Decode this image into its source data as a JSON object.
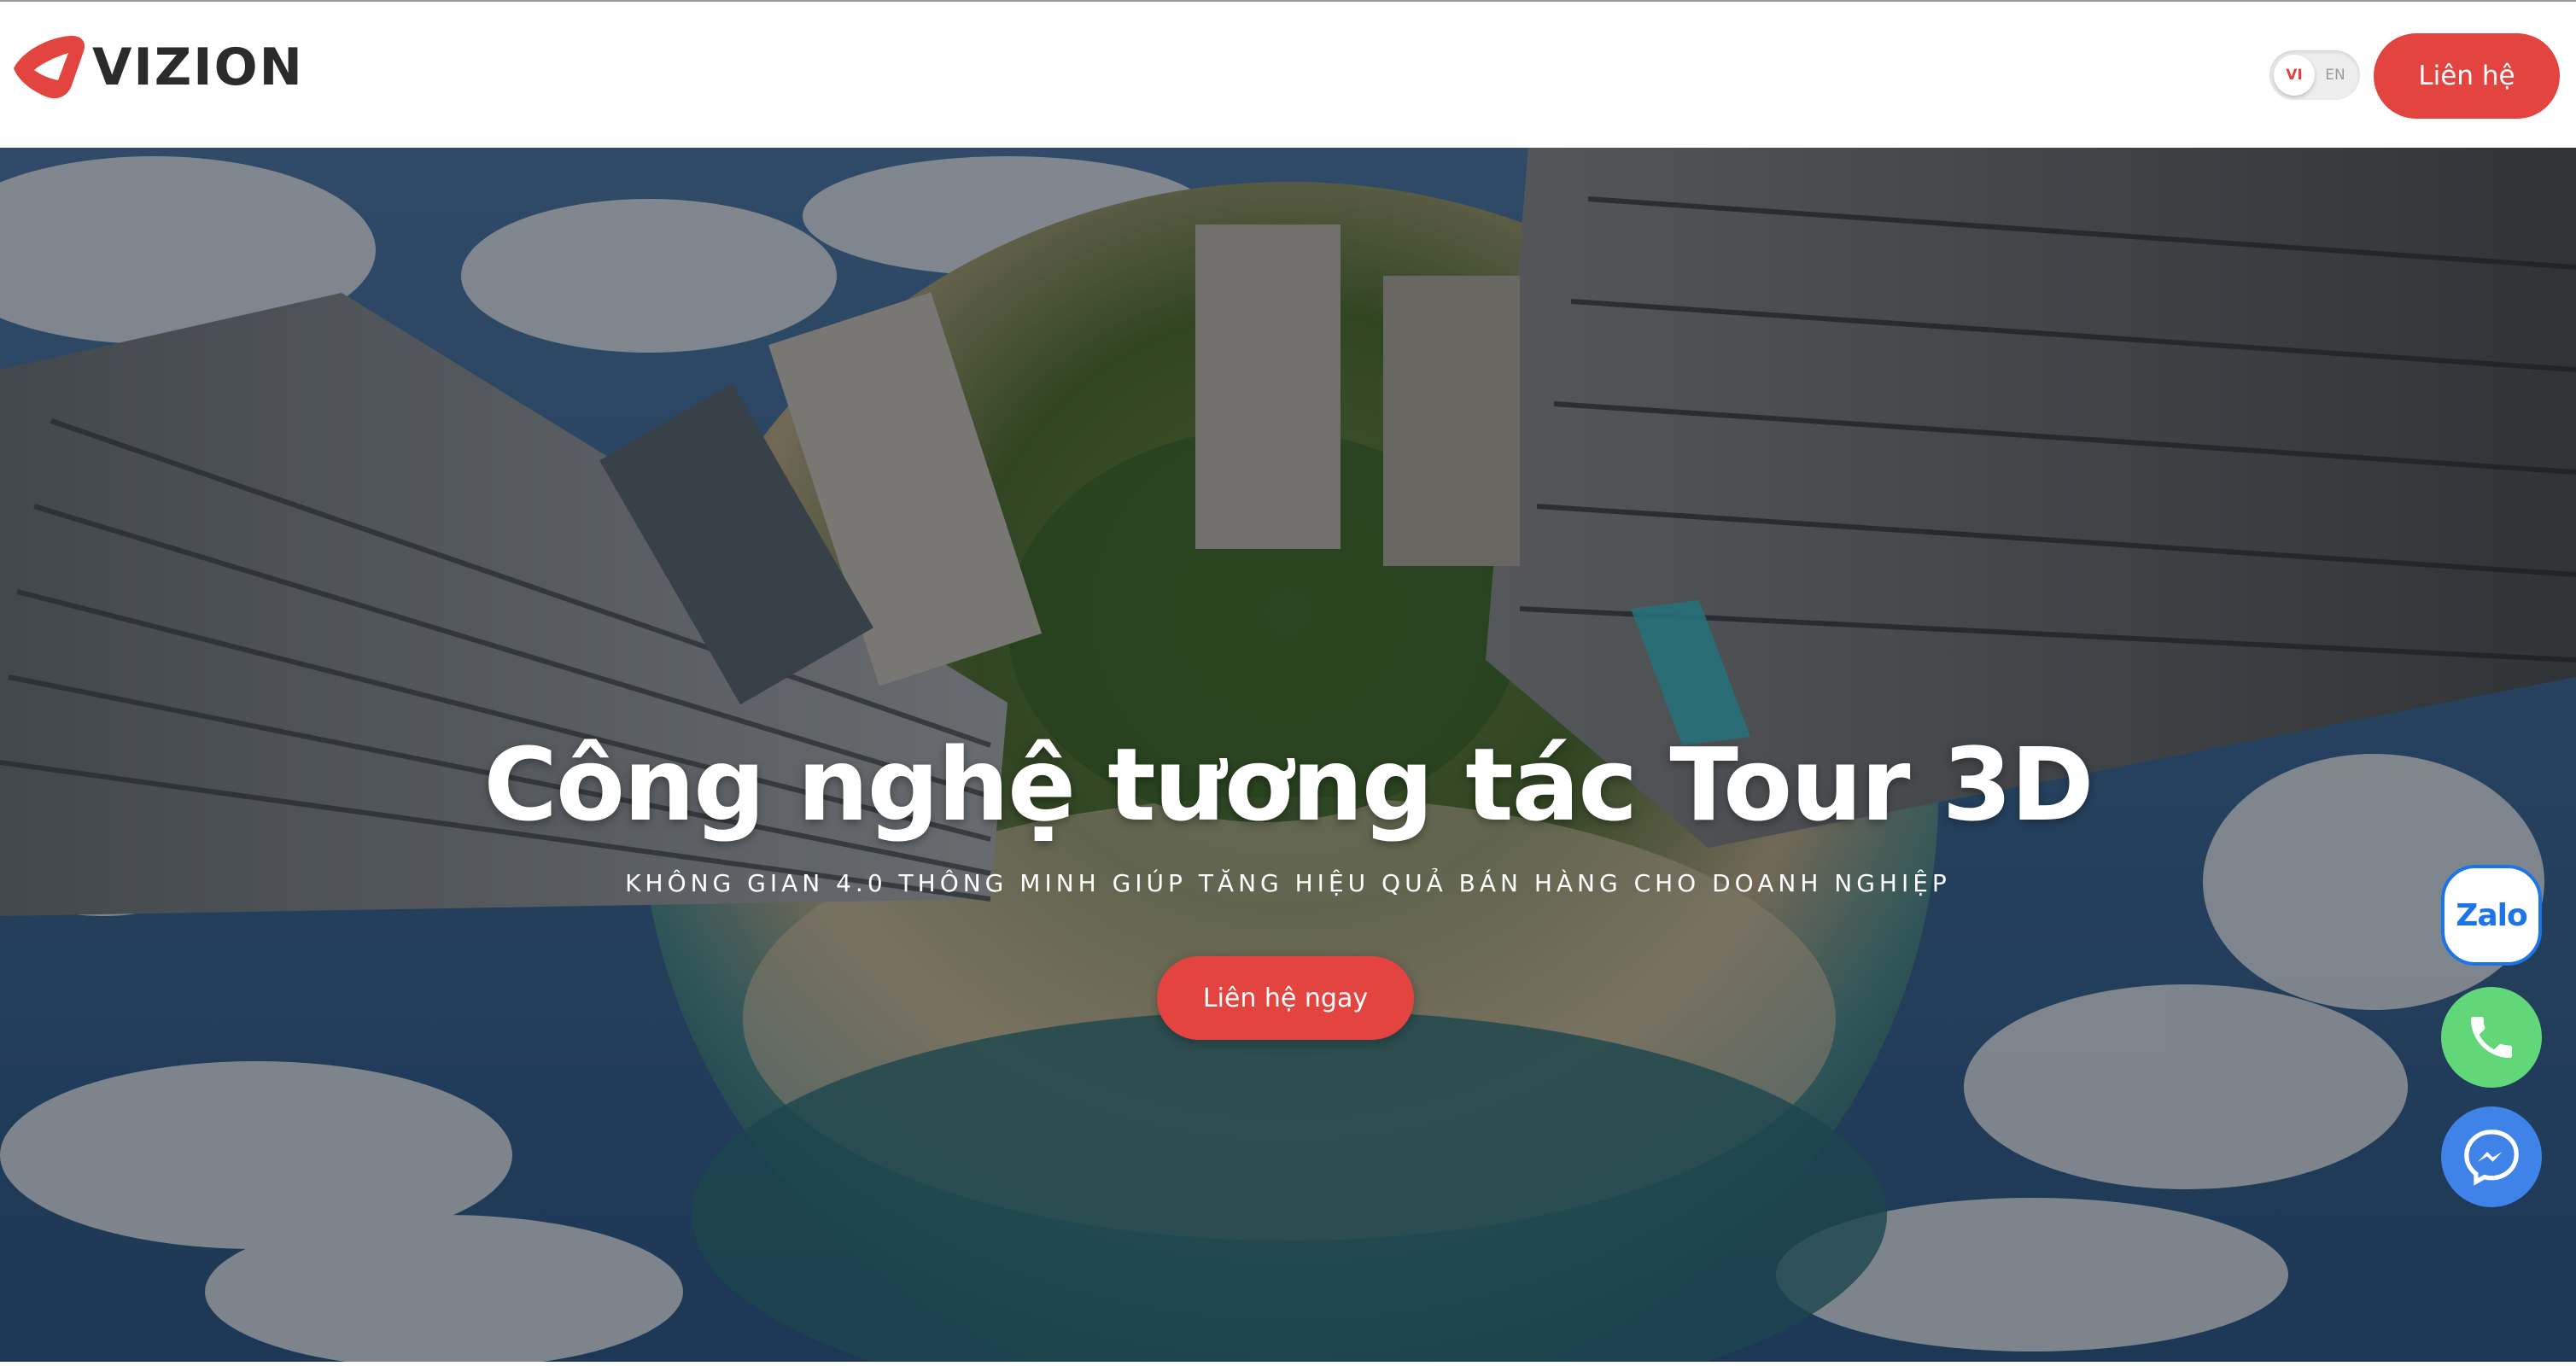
{
  "header": {
    "logo_text": "VIZION",
    "lang": {
      "vi": "VI",
      "en": "EN"
    },
    "contact_label": "Liên hệ"
  },
  "hero": {
    "title": "Công nghệ tương tác Tour 3D",
    "subtitle": "KHÔNG GIAN 4.0 THÔNG MINH GIÚP TĂNG HIỆU QUẢ BÁN HÀNG CHO DOANH NGHIỆP",
    "cta_label": "Liên hệ ngay"
  },
  "floating": {
    "zalo_label": "Zalo"
  },
  "colors": {
    "accent": "#e3443f",
    "phone": "#62d77a",
    "messenger": "#3f82e8",
    "zalo": "#1b74e8"
  },
  "icons": [
    "vizion-logo-icon",
    "phone-icon",
    "messenger-icon",
    "zalo-icon"
  ]
}
